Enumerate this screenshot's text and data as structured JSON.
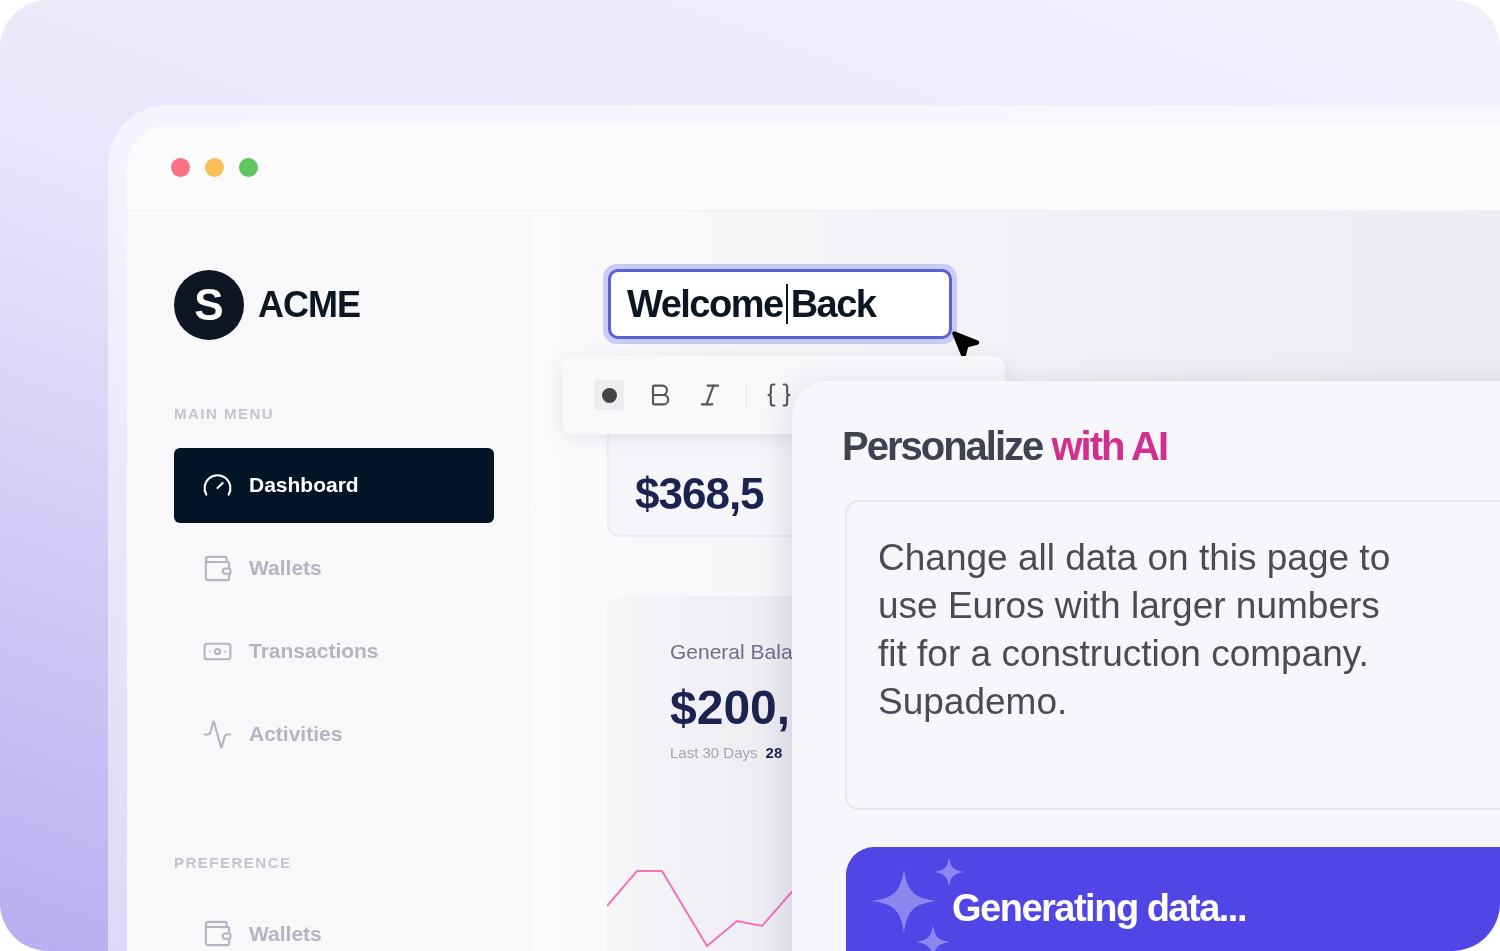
{
  "window": {
    "controls": [
      {
        "color": "#fb7185"
      },
      {
        "color": "#fbbf5a"
      },
      {
        "color": "#5ec75e"
      }
    ]
  },
  "sidebar": {
    "logo": "ACME",
    "logo_letter": "S",
    "sections": [
      {
        "title": "MAIN MENU",
        "items": [
          {
            "label": "Dashboard",
            "kind": "gauge",
            "selected": true
          },
          {
            "label": "Wallets",
            "kind": "wallet",
            "selected": false
          },
          {
            "label": "Transactions",
            "kind": "money",
            "selected": false
          },
          {
            "label": "Activities",
            "kind": "activity",
            "selected": false
          }
        ]
      },
      {
        "title": "PREFERENCE",
        "items": [
          {
            "label": "Wallets",
            "kind": "wallet",
            "selected": false
          }
        ]
      }
    ]
  },
  "title_field": {
    "value": "Welcome Back"
  },
  "format_toolbar": {
    "tools": [
      {
        "kind": "color"
      },
      {
        "kind": "bold"
      },
      {
        "kind": "italic"
      },
      {
        "kind": "code"
      }
    ]
  },
  "cards": [
    {
      "amount": "$368,5"
    },
    {
      "label": "General Bala",
      "amount": "$200,",
      "period": "Last 30 Days",
      "change": "28"
    }
  ],
  "ai_panel": {
    "title": "Personalize",
    "title_highlight": "with AI",
    "prompt": "Change all data on this page to use Euros with larger numbers fit for a construction company. Supademo.",
    "button": "Generating data..."
  }
}
